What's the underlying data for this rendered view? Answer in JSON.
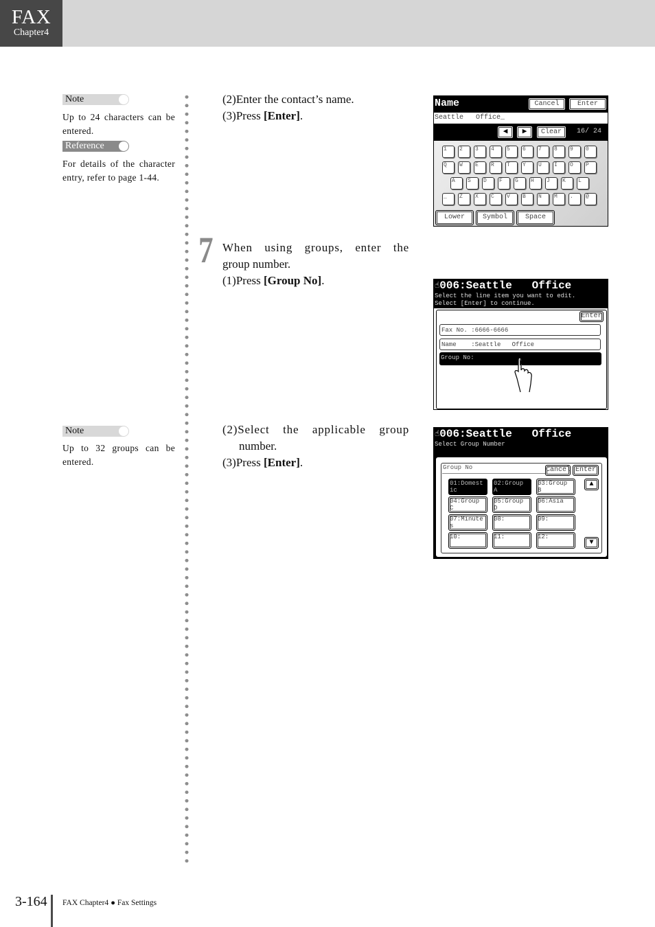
{
  "header": {
    "title": "FAX",
    "chapter": "Chapter4"
  },
  "sidebar": {
    "note1": {
      "label": "Note",
      "text": "Up to 24 characters can be entered."
    },
    "reference": {
      "label": "Reference",
      "text": "For details of the character entry, refer to page 1-44."
    },
    "note2": {
      "label": "Note",
      "text": "Up to 32 groups can be entered."
    }
  },
  "steps": {
    "block1": {
      "line1_num": "(2)",
      "line1": "Enter the contact’s name.",
      "line2_num": "(3)",
      "line2_pre": "Press ",
      "line2_bold": "[Enter]",
      "line2_post": "."
    },
    "step7": {
      "number": "7",
      "intro_line1": "When using groups, enter the",
      "intro_line2": "group number.",
      "sub_num": "(1)",
      "sub_pre": "Press ",
      "sub_bold": "[Group No]",
      "sub_post": "."
    },
    "block3": {
      "line1_num": "(2)",
      "line1a": "Select the applicable group",
      "line1b": "number.",
      "line2_num": "(3)",
      "line2_pre": "Press ",
      "line2_bold": "[Enter]",
      "line2_post": "."
    }
  },
  "screen_name": {
    "title": "Name",
    "cancel": "Cancel",
    "enter": "Enter",
    "input_value": "Seattle   Office_",
    "clear": "Clear",
    "counter": "16/ 24",
    "left_arrow": "◀",
    "right_arrow": "▶",
    "rows": [
      [
        "1",
        "2",
        "3",
        "4",
        "5",
        "6",
        "7",
        "8",
        "9",
        "0"
      ],
      [
        "Q",
        "W",
        "E",
        "R",
        "T",
        "Y",
        "U",
        "I",
        "O",
        "P"
      ],
      [
        "A",
        "S",
        "D",
        "F",
        "G",
        "H",
        "J",
        "K",
        "L"
      ],
      [
        "_",
        "Z",
        "X",
        "C",
        "V",
        "B",
        "N",
        "M",
        ".",
        "@"
      ]
    ],
    "lower": "Lower",
    "symbol": "Symbol",
    "space": "Space"
  },
  "screen_edit": {
    "title": "006:Seattle   Office",
    "instr1": "Select the line item you want to edit.",
    "instr2": "Select [Enter] to continue.",
    "enter": "Enter",
    "items": [
      "Fax No. :6666-6666",
      "Name    :Seattle   Office",
      "Group No:"
    ]
  },
  "screen_group": {
    "title": "006:Seattle   Office",
    "instr": "Select Group Number",
    "panel_label": "Group No",
    "cancel": "Cancel",
    "enter": "Enter",
    "groups": [
      "01:Domestic",
      "02:Group A",
      "03:Group B",
      "04:Group C",
      "05:Group D",
      "06:Asia",
      "07:Minutes",
      "08:",
      "09:",
      "10:",
      "11:",
      "12:"
    ],
    "selected": [
      "01:Domestic",
      "02:Group A"
    ],
    "up": "▲",
    "down": "▼"
  },
  "footer": {
    "page": "3-164",
    "section": "FAX Chapter4",
    "bullet": "●",
    "topic": "Fax Settings"
  }
}
